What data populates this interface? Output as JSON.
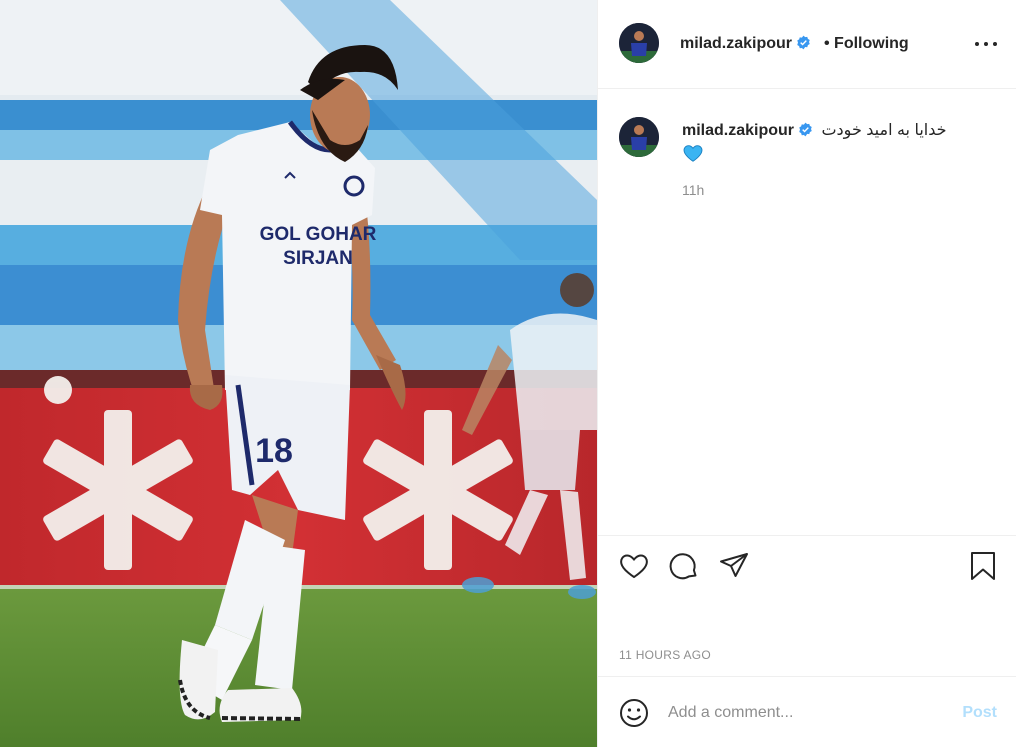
{
  "post": {
    "image_description_icon": "soccer-player-photo"
  },
  "header": {
    "username": "milad.zakipour",
    "follow_status": "• Following",
    "more_icon": "more-horizontal-icon"
  },
  "caption": {
    "username": "milad.zakipour",
    "text": "خدایا به امید خودت",
    "emoji": "blue-heart-icon",
    "time": "11h"
  },
  "jersey": {
    "sponsor_line1": "GOL GOHAR",
    "sponsor_line2": "SIRJAN",
    "number": "18"
  },
  "actions": {
    "like_icon": "heart-outline-icon",
    "comment_icon": "comment-bubble-icon",
    "share_icon": "paper-plane-icon",
    "save_icon": "bookmark-icon"
  },
  "timestamp": "11 HOURS AGO",
  "comment": {
    "placeholder": "Add a comment...",
    "post_label": "Post",
    "emoji_icon": "smiley-icon"
  },
  "colors": {
    "verified": "#3897f0",
    "post_disabled": "#b2dffc",
    "text_secondary": "#8e8e8e"
  }
}
